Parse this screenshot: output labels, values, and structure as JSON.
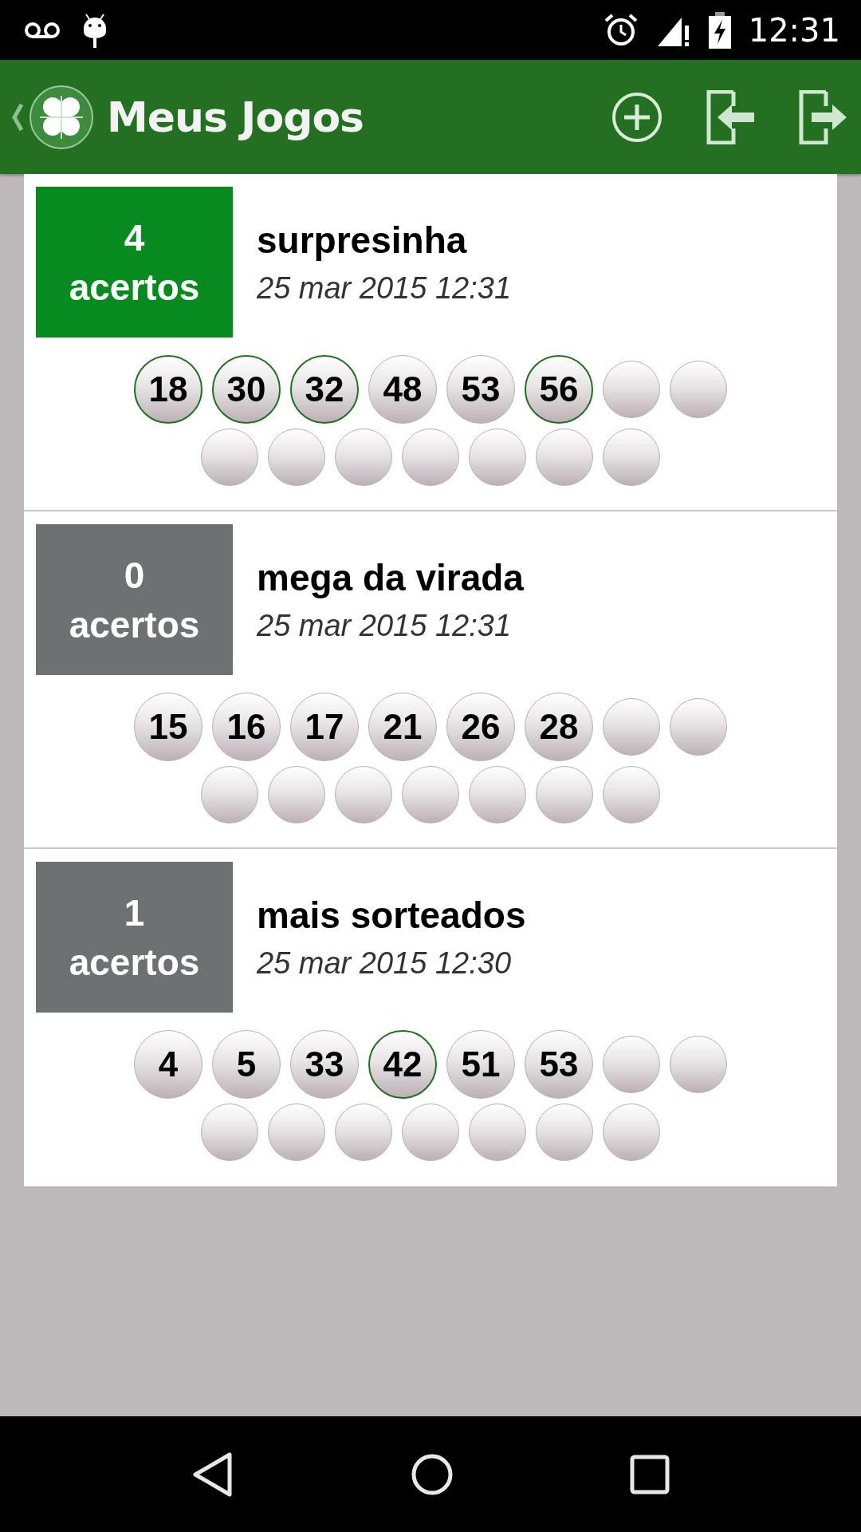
{
  "status_bar": {
    "time": "12:31"
  },
  "app_bar": {
    "title": "Meus Jogos"
  },
  "games": [
    {
      "score": "4",
      "score_label": "acertos",
      "color": "#078a1e",
      "title": "surpresinha",
      "date": "25 mar 2015 12:31",
      "balls": [
        {
          "kind": "number",
          "number": "18",
          "hit": true
        },
        {
          "kind": "number",
          "number": "30",
          "hit": true
        },
        {
          "kind": "number",
          "number": "32",
          "hit": true
        },
        {
          "kind": "number",
          "number": "48",
          "hit": false
        },
        {
          "kind": "number",
          "number": "53",
          "hit": false
        },
        {
          "kind": "number",
          "number": "56",
          "hit": true
        },
        {
          "kind": "empty"
        },
        {
          "kind": "empty"
        },
        {
          "kind": "empty"
        },
        {
          "kind": "empty"
        },
        {
          "kind": "empty"
        },
        {
          "kind": "empty"
        },
        {
          "kind": "empty"
        },
        {
          "kind": "empty"
        },
        {
          "kind": "empty"
        }
      ]
    },
    {
      "score": "0",
      "score_label": "acertos",
      "color": "#6d7171",
      "title": "mega da virada",
      "date": "25 mar 2015 12:31",
      "balls": [
        {
          "kind": "number",
          "number": "15",
          "hit": false
        },
        {
          "kind": "number",
          "number": "16",
          "hit": false
        },
        {
          "kind": "number",
          "number": "17",
          "hit": false
        },
        {
          "kind": "number",
          "number": "21",
          "hit": false
        },
        {
          "kind": "number",
          "number": "26",
          "hit": false
        },
        {
          "kind": "number",
          "number": "28",
          "hit": false
        },
        {
          "kind": "empty"
        },
        {
          "kind": "empty"
        },
        {
          "kind": "empty"
        },
        {
          "kind": "empty"
        },
        {
          "kind": "empty"
        },
        {
          "kind": "empty"
        },
        {
          "kind": "empty"
        },
        {
          "kind": "empty"
        },
        {
          "kind": "empty"
        }
      ]
    },
    {
      "score": "1",
      "score_label": "acertos",
      "color": "#6d7171",
      "title": "mais sorteados",
      "date": "25 mar 2015 12:30",
      "balls": [
        {
          "kind": "number",
          "number": "4",
          "hit": false
        },
        {
          "kind": "number",
          "number": "5",
          "hit": false
        },
        {
          "kind": "number",
          "number": "33",
          "hit": false
        },
        {
          "kind": "number",
          "number": "42",
          "hit": true
        },
        {
          "kind": "number",
          "number": "51",
          "hit": false
        },
        {
          "kind": "number",
          "number": "53",
          "hit": false
        },
        {
          "kind": "empty"
        },
        {
          "kind": "empty"
        },
        {
          "kind": "empty"
        },
        {
          "kind": "empty"
        },
        {
          "kind": "empty"
        },
        {
          "kind": "empty"
        },
        {
          "kind": "empty"
        },
        {
          "kind": "empty"
        },
        {
          "kind": "empty"
        }
      ]
    }
  ]
}
